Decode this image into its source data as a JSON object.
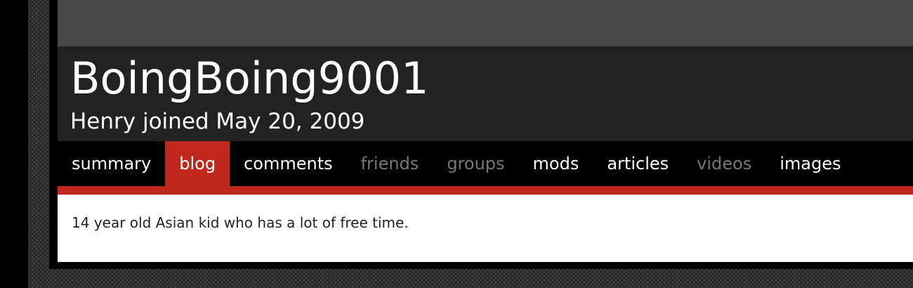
{
  "profile": {
    "username": "BoingBoing9001",
    "joined_line": "Henry joined May 20, 2009",
    "bio": "14 year old Asian kid who has a lot of free time."
  },
  "nav": {
    "tabs": [
      {
        "label": "summary",
        "state": "normal"
      },
      {
        "label": "blog",
        "state": "active"
      },
      {
        "label": "comments",
        "state": "normal"
      },
      {
        "label": "friends",
        "state": "disabled"
      },
      {
        "label": "groups",
        "state": "disabled"
      },
      {
        "label": "mods",
        "state": "normal"
      },
      {
        "label": "articles",
        "state": "normal"
      },
      {
        "label": "videos",
        "state": "disabled"
      },
      {
        "label": "images",
        "state": "normal"
      }
    ]
  },
  "colors": {
    "accent": "#c0281e",
    "header_bg": "#222222",
    "top_band": "#474747",
    "disabled_text": "#777777"
  }
}
